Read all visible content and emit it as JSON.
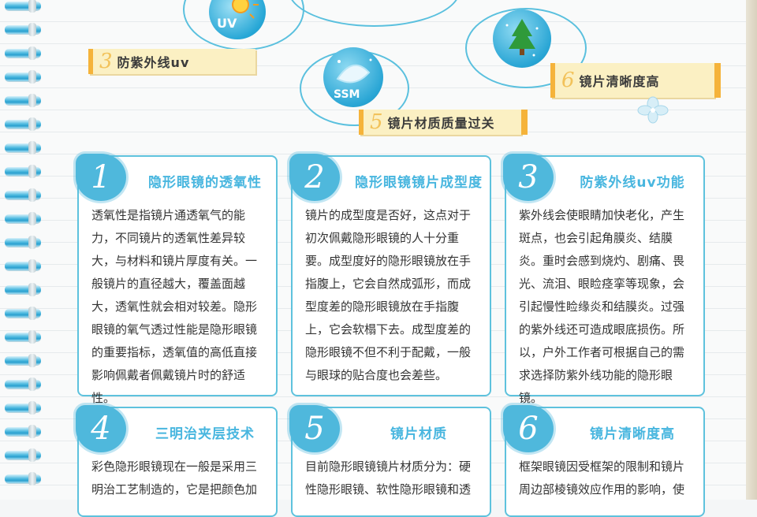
{
  "features": {
    "uv_badge_label": "UV",
    "ssm_badge_label": "SSM",
    "tag3": {
      "number": "3",
      "label": "防紫外线uv"
    },
    "tag5": {
      "number": "5",
      "label": "镜片材质质量过关"
    },
    "tag6": {
      "number": "6",
      "label": "镜片清晰度高"
    }
  },
  "cards": [
    {
      "number": "1",
      "title": "隐形眼镜的透氧性",
      "text": "透氧性是指镜片通透氧气的能力，不同镜片的透氧性差异较大，与材料和镜片厚度有关。一般镜片的直径越大，覆盖面越大，透氧性就会相对较差。隐形眼镜的氧气透过性能是隐形眼镜的重要指标，透氧值的高低直接影响佩戴者佩戴镜片时的舒适性。"
    },
    {
      "number": "2",
      "title": "隐形眼镜镜片成型度",
      "text": "镜片的成型度是否好，这点对于初次佩戴隐形眼镜的人十分重要。成型度好的隐形眼镜放在手指腹上，它会自然成弧形，而成型度差的隐形眼镜放在手指腹上，它会软榻下去。成型度差的隐形眼镜不但不利于配戴，一般与眼球的贴合度也会差些。"
    },
    {
      "number": "3",
      "title": "防紫外线uv功能",
      "text": "紫外线会使眼睛加快老化，产生斑点，也会引起角膜炎、结膜炎。重时会感到烧灼、剧痛、畏光、流泪、眼睑痉挛等现象，会引起慢性睑缘炎和结膜炎。过强的紫外线还可造成眼底损伤。所以，户外工作者可根据自己的需求选择防紫外线功能的隐形眼镜。"
    },
    {
      "number": "4",
      "title": "三明治夹层技术",
      "text": "彩色隐形眼镜现在一般是采用三明治工艺制造的，它是把颜色加"
    },
    {
      "number": "5",
      "title": "镜片材质",
      "text": "目前隐形眼镜镜片材质分为：硬性隐形眼镜、软性隐形眼镜和透"
    },
    {
      "number": "6",
      "title": "镜片清晰度高",
      "text": "框架眼镜因受框架的限制和镜片周边部棱镜效应作用的影响，使"
    }
  ]
}
